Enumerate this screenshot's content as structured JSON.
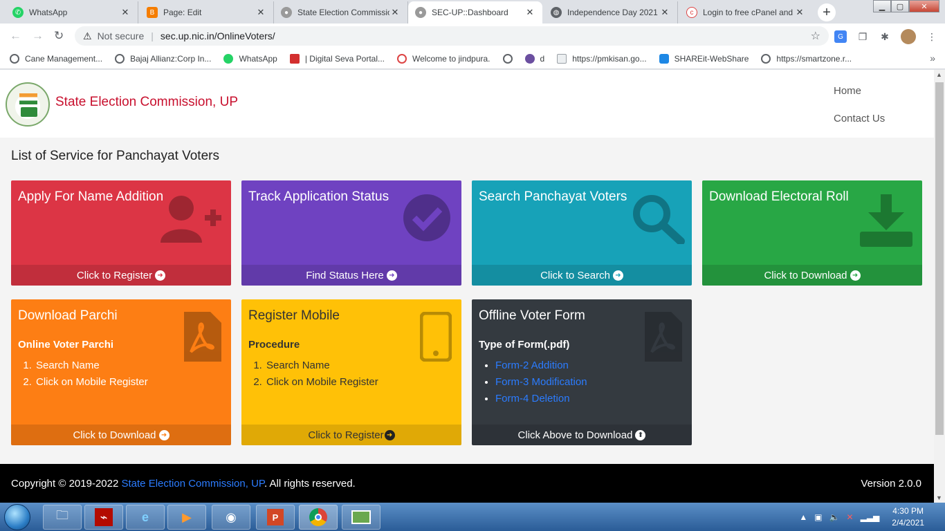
{
  "tabs": [
    {
      "title": "WhatsApp",
      "icon": "whatsapp-icon",
      "color": "#25d366"
    },
    {
      "title": "Page: Edit",
      "icon": "blogger-icon",
      "color": "#f57d00"
    },
    {
      "title": "State Election Commissio",
      "icon": "emblem-icon",
      "color": "#8a8a8a"
    },
    {
      "title": "SEC-UP::Dashboard",
      "icon": "emblem-icon",
      "color": "#8a8a8a"
    },
    {
      "title": "Independence Day 2021",
      "icon": "globe-icon",
      "color": "#5f6368"
    },
    {
      "title": "Login to free cPanel and",
      "icon": "cpanel-icon",
      "color": "#d44"
    }
  ],
  "address": {
    "security": "Not secure",
    "url": "sec.up.nic.in/OnlineVoters/"
  },
  "bookmarks": [
    {
      "label": "Cane Management...",
      "color": "#5f6368"
    },
    {
      "label": "Bajaj Allianz:Corp In...",
      "color": "#5f6368"
    },
    {
      "label": "WhatsApp",
      "color": "#25d366"
    },
    {
      "label": "| Digital Seva Portal...",
      "color": "#d32f2f"
    },
    {
      "label": "Welcome to jindpura.",
      "color": "#d44"
    },
    {
      "label": "",
      "color": "#5f6368"
    },
    {
      "label": "d",
      "color": "#6b4fa0"
    },
    {
      "label": "https://pmkisan.go...",
      "color": "#9aa0a6"
    },
    {
      "label": "SHAREit-WebShare",
      "color": "#1e88e5"
    },
    {
      "label": "https://smartzone.r...",
      "color": "#5f6368"
    }
  ],
  "site": {
    "title": "State Election Commission, UP",
    "nav": [
      "Home",
      "Contact Us"
    ],
    "heading": "List of Service for Panchayat Voters"
  },
  "cards": {
    "name_addition": {
      "title": "Apply For Name Addition",
      "footer": "Click to Register"
    },
    "track_status": {
      "title": "Track Application Status",
      "footer": "Find Status Here"
    },
    "search_voters": {
      "title": "Search Panchayat Voters",
      "footer": "Click to Search"
    },
    "electoral_roll": {
      "title": "Download Electoral Roll",
      "footer": "Click to Download"
    },
    "parchi": {
      "title": "Download Parchi",
      "subtitle": "Online Voter Parchi",
      "steps": [
        "Search Name",
        "Click on Mobile Register"
      ],
      "footer": "Click to Download"
    },
    "register_mobile": {
      "title": "Register Mobile",
      "subtitle": "Procedure",
      "steps": [
        "Search Name",
        "Click on Mobile Register"
      ],
      "footer": "Click to Register"
    },
    "offline_form": {
      "title": "Offline Voter Form",
      "subtitle": "Type of Form(.pdf)",
      "links": [
        "Form-2 Addition",
        "Form-3 Modification",
        "Form-4 Deletion"
      ],
      "footer": "Click Above to Download"
    }
  },
  "footer": {
    "copy_prefix": "Copyright © 2019-2022",
    "copy_link": "State Election Commission, UP",
    "copy_suffix": ". All rights reserved.",
    "version_label": "Version",
    "version": "2.0.0"
  },
  "taskbar": {
    "time": "4:30 PM",
    "date": "2/4/2021"
  }
}
